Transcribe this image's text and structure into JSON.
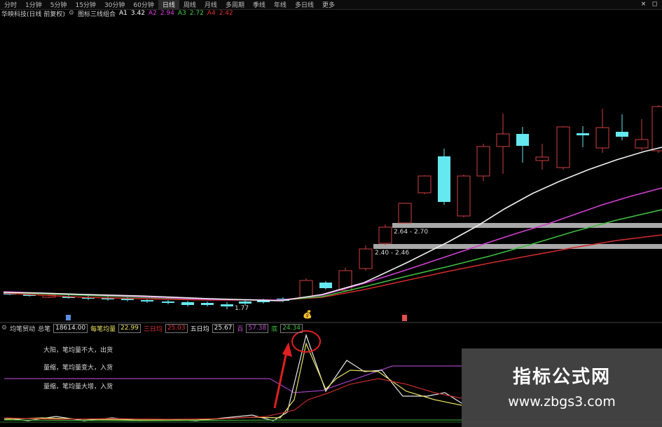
{
  "period_bar": {
    "tabs": [
      "分时",
      "1分钟",
      "5分钟",
      "15分钟",
      "30分钟",
      "60分钟",
      "日线",
      "周线",
      "月线",
      "多周期",
      "季线",
      "年线",
      "多日线",
      "更多"
    ],
    "active_tab": "日线",
    "window_buttons": [
      "×",
      "◻"
    ]
  },
  "main_indicator": {
    "stock_name": "华映科技(日线 前复权)",
    "indicator": "图标三线组合",
    "a1_label": "A1",
    "a1_value": "3.42",
    "a2_label": "A2",
    "a2_value": "2.94",
    "a3_label": "A3",
    "a3_value": "2.72",
    "a4_label": "A4",
    "a4_value": "2.42",
    "colors": {
      "a1": "#ffffff",
      "a2": "#e040e0",
      "a3": "#40d040",
      "a4": "#e03030"
    }
  },
  "price_annotations": {
    "upper_band": "2.64 - 2.70",
    "lower_band": "2.40 - 2.46",
    "low_mark": "1.77"
  },
  "sub_indicator": {
    "name": "均笔贸动",
    "total_label": "总笔",
    "total_value": "18614.00",
    "avg_label": "每笔均量",
    "avg_value": "22.99",
    "d3_label": "三日均",
    "d3_value": "25.03",
    "d5_label": "五日均",
    "d5_value": "25.67",
    "hundred_label": "百",
    "hundred_value": "57.38",
    "low_label": "底",
    "low_value": "24.34",
    "legend": [
      "大阳，笔均量不大，出货",
      "量缩，笔均量变大，入货",
      "量缩，笔均量大增，入货"
    ]
  },
  "watermark": {
    "title": "指标公式网",
    "url": "www.zbgs3.com"
  }
}
